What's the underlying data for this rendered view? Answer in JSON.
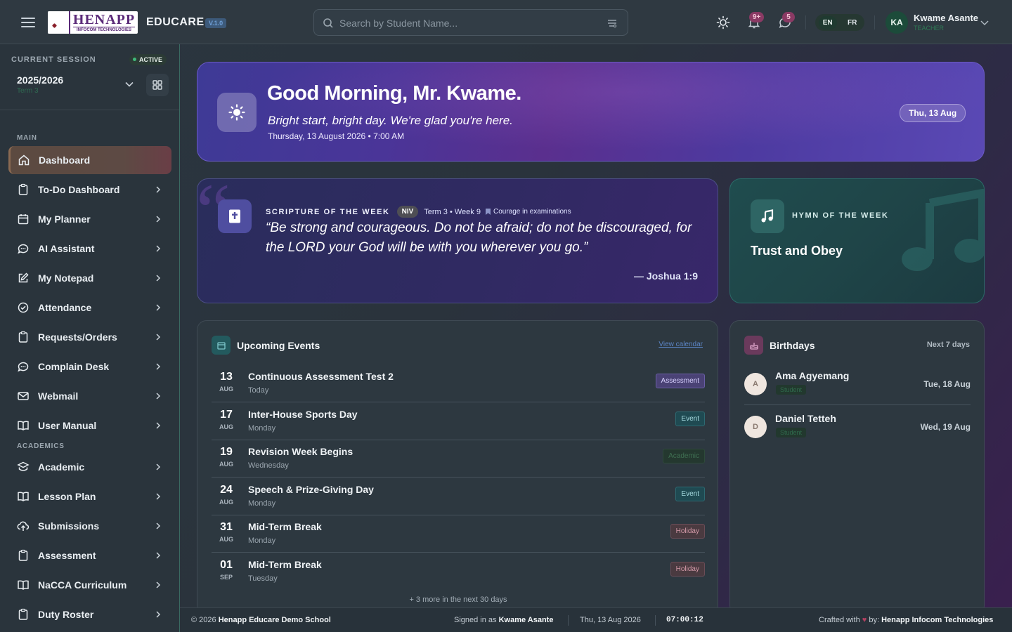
{
  "header": {
    "brand": "EDUCARE",
    "version": "V.1.0",
    "logo_text": "HENAPP",
    "logo_subtext": "INFOCOM TECHNOLOGIES",
    "search_placeholder": "Search by Student Name...",
    "notif_count": "9+",
    "message_count": "5",
    "lang_en": "EN",
    "lang_fr": "FR",
    "user_initials": "KA",
    "user_name": "Kwame Asante",
    "user_role": "TEACHER"
  },
  "sidebar": {
    "session_label": "CURRENT SESSION",
    "session_status": "ACTIVE",
    "session_year": "2025/2026",
    "session_term": "Term 3",
    "main_label": "MAIN",
    "academics_label": "ACADEMICS",
    "main_items": [
      {
        "label": "Dashboard",
        "icon": "home-icon"
      },
      {
        "label": "To-Do Dashboard",
        "icon": "clipboard-icon"
      },
      {
        "label": "My Planner",
        "icon": "calendar-icon"
      },
      {
        "label": "AI Assistant",
        "icon": "chat-icon"
      },
      {
        "label": "My Notepad",
        "icon": "edit-icon"
      },
      {
        "label": "Attendance",
        "icon": "check-circle-icon"
      },
      {
        "label": "Requests/Orders",
        "icon": "clipboard-icon"
      },
      {
        "label": "Complain Desk",
        "icon": "chat-icon"
      },
      {
        "label": "Webmail",
        "icon": "mail-icon"
      },
      {
        "label": "User Manual",
        "icon": "book-icon"
      }
    ],
    "academic_items": [
      {
        "label": "Academic",
        "icon": "layers-icon"
      },
      {
        "label": "Lesson Plan",
        "icon": "book-icon"
      },
      {
        "label": "Submissions",
        "icon": "upload-icon"
      },
      {
        "label": "Assessment",
        "icon": "clipboard-icon"
      },
      {
        "label": "NaCCA Curriculum",
        "icon": "book-icon"
      },
      {
        "label": "Duty Roster",
        "icon": "clipboard-icon"
      }
    ]
  },
  "hero": {
    "greeting": "Good Morning, Mr. Kwame.",
    "subtitle": "Bright start, bright day. We're glad you're here.",
    "datetime": "Thursday, 13 August 2026 • 7:00 AM",
    "date_pill": "Thu, 13 Aug"
  },
  "scripture": {
    "label": "SCRIPTURE OF THE WEEK",
    "version": "NIV",
    "term_week": "Term 3 • Week 9",
    "theme": "Courage in examinations",
    "verse": "“Be strong and courageous. Do not be afraid; do not be discouraged, for the LORD your God will be with you wherever you go.”",
    "reference": "— Joshua 1:9"
  },
  "hymn": {
    "label": "HYMN OF THE WEEK",
    "title": "Trust and Obey"
  },
  "events": {
    "title": "Upcoming Events",
    "view_calendar": "View calendar",
    "items": [
      {
        "day": "13",
        "month": "AUG",
        "title": "Continuous Assessment Test 2",
        "sub": "Today",
        "tag": "Assessment",
        "kind": "assessment"
      },
      {
        "day": "17",
        "month": "AUG",
        "title": "Inter-House Sports Day",
        "sub": "Monday",
        "tag": "Event",
        "kind": "event"
      },
      {
        "day": "19",
        "month": "AUG",
        "title": "Revision Week Begins",
        "sub": "Wednesday",
        "tag": "Academic",
        "kind": "academic"
      },
      {
        "day": "24",
        "month": "AUG",
        "title": "Speech & Prize-Giving Day",
        "sub": "Monday",
        "tag": "Event",
        "kind": "event"
      },
      {
        "day": "31",
        "month": "AUG",
        "title": "Mid-Term Break",
        "sub": "Monday",
        "tag": "Holiday",
        "kind": "holiday"
      },
      {
        "day": "01",
        "month": "SEP",
        "title": "Mid-Term Break",
        "sub": "Tuesday",
        "tag": "Holiday",
        "kind": "holiday"
      }
    ],
    "more": "+ 3 more in the next 30 days"
  },
  "birthdays": {
    "title": "Birthdays",
    "range": "Next 7 days",
    "items": [
      {
        "initial": "A",
        "name": "Ama Agyemang",
        "role": "Student",
        "date": "Tue, 18 Aug"
      },
      {
        "initial": "D",
        "name": "Daniel Tetteh",
        "role": "Student",
        "date": "Wed, 19 Aug"
      }
    ]
  },
  "footer": {
    "copyright_prefix": "© 2026",
    "school": "Henapp Educare Demo School",
    "signed_prefix": "Signed in as",
    "signed_user": "Kwame Asante",
    "date": "Thu, 13 Aug 2026",
    "clock": "07:00:12",
    "crafted_prefix": "Crafted with",
    "crafted_by": "by:",
    "company": "Henapp Infocom Technologies"
  }
}
